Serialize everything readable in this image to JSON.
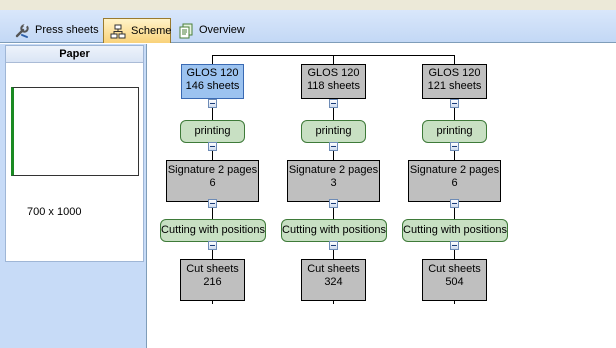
{
  "tabs": [
    {
      "label": "Press sheets",
      "icon": "wrench-icon"
    },
    {
      "label": "Scheme",
      "icon": "network-icon"
    },
    {
      "label": "Overview",
      "icon": "pages-icon"
    }
  ],
  "active_tab": "Scheme",
  "paper_panel": {
    "title": "Paper",
    "size": "700 x 1000"
  },
  "columns": [
    {
      "sheets_title": "GLOS 120",
      "sheets_count": "146 sheets",
      "process": "printing",
      "signature_title": "Signature 2 pages",
      "signature_count": "6",
      "cutting": "Cutting with positions",
      "cut_title": "Cut sheets",
      "cut_count": "216"
    },
    {
      "sheets_title": "GLOS 120",
      "sheets_count": "118 sheets",
      "process": "printing",
      "signature_title": "Signature 2 pages",
      "signature_count": "3",
      "cutting": "Cutting with positions",
      "cut_title": "Cut sheets",
      "cut_count": "324"
    },
    {
      "sheets_title": "GLOS 120",
      "sheets_count": "121 sheets",
      "process": "printing",
      "signature_title": "Signature 2 pages",
      "signature_count": "6",
      "cutting": "Cutting with positions",
      "cut_title": "Cut sheets",
      "cut_count": "504"
    }
  ],
  "colors": {
    "selected_node": "#9cc3f0",
    "sheet_node": "#bfbfbf",
    "process_node": "#c8e0c3",
    "active_tab": "#f9d27a"
  }
}
